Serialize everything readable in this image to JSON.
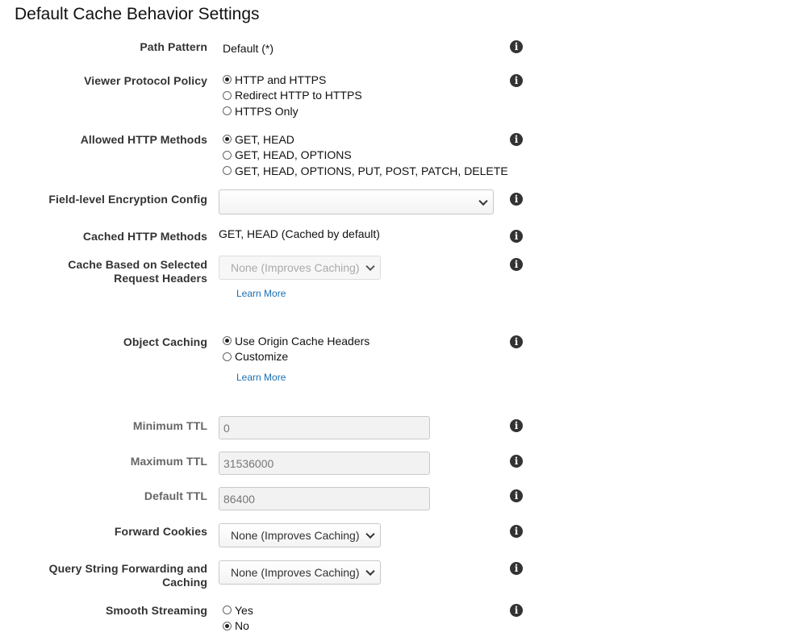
{
  "page_title": "Default Cache Behavior Settings",
  "path_pattern": {
    "label": "Path Pattern",
    "value": "Default (*)"
  },
  "viewer_protocol": {
    "label": "Viewer Protocol Policy",
    "options": [
      "HTTP and HTTPS",
      "Redirect HTTP to HTTPS",
      "HTTPS Only"
    ],
    "selected": "HTTP and HTTPS"
  },
  "allowed_methods": {
    "label": "Allowed HTTP Methods",
    "options": [
      "GET, HEAD",
      "GET, HEAD, OPTIONS",
      "GET, HEAD, OPTIONS, PUT, POST, PATCH, DELETE"
    ],
    "selected": "GET, HEAD"
  },
  "fle_config": {
    "label": "Field-level Encryption Config",
    "value": ""
  },
  "cached_methods": {
    "label": "Cached HTTP Methods",
    "value": "GET, HEAD (Cached by default)"
  },
  "cache_headers": {
    "label_line1": "Cache Based on Selected",
    "label_line2": "Request Headers",
    "value": "None (Improves Caching)",
    "learn_more": "Learn More"
  },
  "object_caching": {
    "label": "Object Caching",
    "options": [
      "Use Origin Cache Headers",
      "Customize"
    ],
    "selected": "Use Origin Cache Headers",
    "learn_more": "Learn More"
  },
  "min_ttl": {
    "label": "Minimum TTL",
    "value": "0"
  },
  "max_ttl": {
    "label": "Maximum TTL",
    "value": "31536000"
  },
  "default_ttl": {
    "label": "Default TTL",
    "value": "86400"
  },
  "forward_cookies": {
    "label": "Forward Cookies",
    "value": "None (Improves Caching)"
  },
  "query_string": {
    "label_line1": "Query String Forwarding and",
    "label_line2": "Caching",
    "value": "None (Improves Caching)"
  },
  "smooth_streaming": {
    "label": "Smooth Streaming",
    "options": [
      "Yes",
      "No"
    ],
    "selected": "No"
  },
  "info_icon_glyph": "i"
}
